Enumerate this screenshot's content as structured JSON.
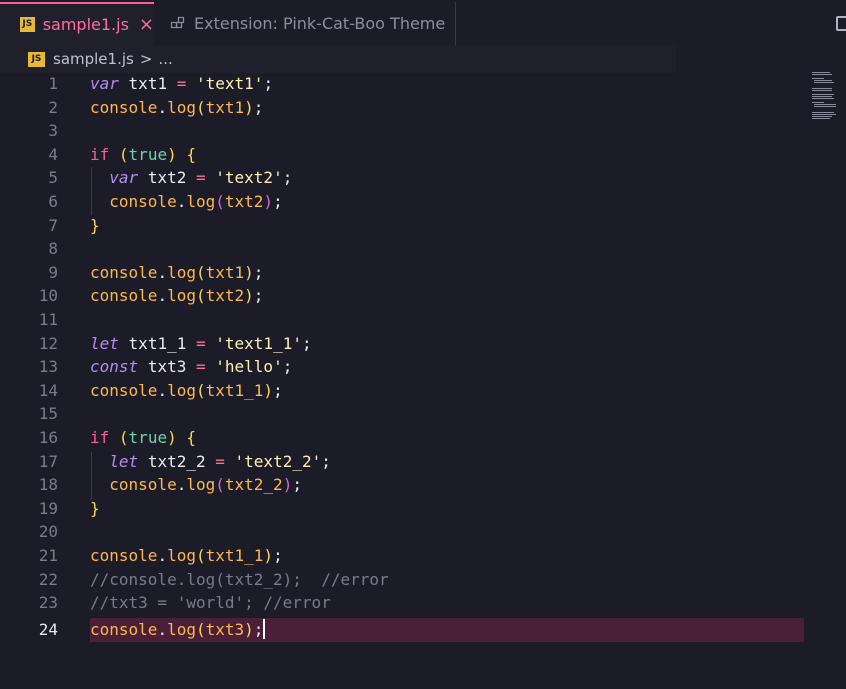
{
  "tabs": [
    {
      "label": "sample1.js",
      "icon": "JS",
      "active": true
    },
    {
      "label": "Extension: Pink-Cat-Boo Theme",
      "active": false
    }
  ],
  "breadcrumb": {
    "file": "sample1.js",
    "separator": ">",
    "more": "..."
  },
  "editor": {
    "current_line": 24,
    "lines": [
      {
        "n": "1"
      },
      {
        "n": "2"
      },
      {
        "n": "3"
      },
      {
        "n": "4"
      },
      {
        "n": "5"
      },
      {
        "n": "6"
      },
      {
        "n": "7"
      },
      {
        "n": "8"
      },
      {
        "n": "9"
      },
      {
        "n": "10"
      },
      {
        "n": "11"
      },
      {
        "n": "12"
      },
      {
        "n": "13"
      },
      {
        "n": "14"
      },
      {
        "n": "15"
      },
      {
        "n": "16"
      },
      {
        "n": "17"
      },
      {
        "n": "18"
      },
      {
        "n": "19"
      },
      {
        "n": "20"
      },
      {
        "n": "21"
      },
      {
        "n": "22"
      },
      {
        "n": "23"
      },
      {
        "n": "24"
      }
    ],
    "tokens": {
      "var": "var",
      "let": "let",
      "const": "const",
      "if": "if",
      "true": "true",
      "console": "console",
      "log": "log",
      "txt1": "txt1",
      "txt2": "txt2",
      "txt1_1": "txt1_1",
      "txt2_2": "txt2_2",
      "txt3": "txt3",
      "s_text1": "'text1'",
      "s_text2": "'text2'",
      "s_text1_1": "'text1_1'",
      "s_hello": "'hello'",
      "s_text2_2": "'text2_2'",
      "comment22": "//console.log(txt2_2);  //error",
      "comment23": "//txt3 = 'world'; //error"
    }
  },
  "colors": {
    "background": "#1c1c28",
    "accent_pink": "#ff5b9a",
    "current_line": "#4a1f38"
  }
}
